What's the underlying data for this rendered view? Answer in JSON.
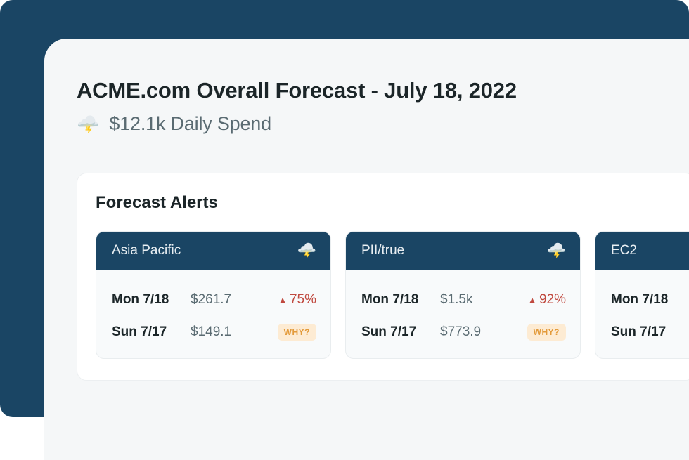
{
  "header": {
    "title": "ACME.com Overall Forecast - July 18, 2022",
    "subtitle": "$12.1k Daily Spend",
    "icon_name": "storm-cloud-icon",
    "icon_glyph": "🌩️"
  },
  "alerts": {
    "title": "Forecast Alerts",
    "why_label": "WHY?",
    "cards": [
      {
        "name": "Asia Pacific",
        "icon_glyph": "🌩️",
        "rows": [
          {
            "date": "Mon 7/18",
            "value": "$261.7",
            "delta": "75%",
            "direction": "up"
          },
          {
            "date": "Sun 7/17",
            "value": "$149.1"
          }
        ]
      },
      {
        "name": "PII/true",
        "icon_glyph": "🌩️",
        "rows": [
          {
            "date": "Mon 7/18",
            "value": "$1.5k",
            "delta": "92%",
            "direction": "up"
          },
          {
            "date": "Sun 7/17",
            "value": "$773.9"
          }
        ]
      },
      {
        "name": "EC2",
        "icon_glyph": "🌩️",
        "rows": [
          {
            "date": "Mon 7/18",
            "value": ""
          },
          {
            "date": "Sun 7/17",
            "value": ""
          }
        ]
      }
    ]
  }
}
